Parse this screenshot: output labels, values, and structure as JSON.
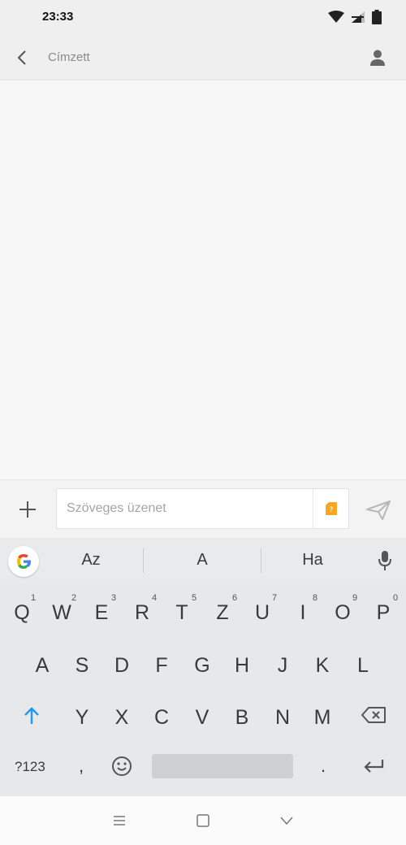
{
  "status_bar": {
    "time": "23:33",
    "icons": [
      "wifi-icon",
      "signal-icon",
      "battery-icon"
    ]
  },
  "header": {
    "recipient_placeholder": "Címzett",
    "back_icon": "chevron-left-icon",
    "contact_icon": "person-icon"
  },
  "composer": {
    "placeholder": "Szöveges üzenet",
    "value": "",
    "sim_label": "?",
    "add_icon": "plus-icon",
    "send_icon": "send-icon"
  },
  "keyboard": {
    "suggestions": [
      "Az",
      "A",
      "Ha"
    ],
    "row1": [
      "Q",
      "W",
      "E",
      "R",
      "T",
      "Z",
      "U",
      "I",
      "O",
      "P"
    ],
    "row1_hints": [
      "1",
      "2",
      "3",
      "4",
      "5",
      "6",
      "7",
      "8",
      "9",
      "0"
    ],
    "row2": [
      "A",
      "S",
      "D",
      "F",
      "G",
      "H",
      "J",
      "K",
      "L"
    ],
    "row3": [
      "Y",
      "X",
      "C",
      "V",
      "B",
      "N",
      "M"
    ],
    "symbols_label": "?123",
    "comma": ",",
    "period": "."
  },
  "colors": {
    "accent_blue": "#2196f3",
    "sim_orange": "#f5a623"
  }
}
